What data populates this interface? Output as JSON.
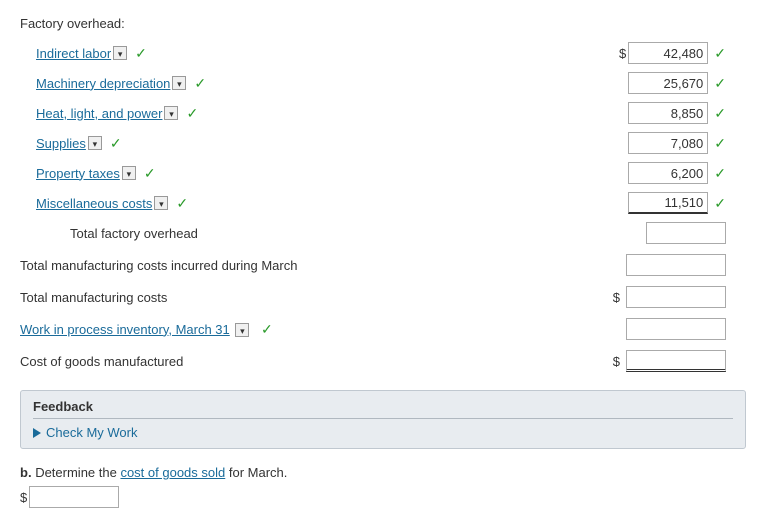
{
  "factory_overhead": {
    "header": "Factory overhead:",
    "items": [
      {
        "label": "Indirect labor",
        "amount": "42,480",
        "has_dollar": true
      },
      {
        "label": "Machinery depreciation",
        "amount": "25,670",
        "has_dollar": false
      },
      {
        "label": "Heat, light, and power",
        "amount": "8,850",
        "has_dollar": false
      },
      {
        "label": "Supplies",
        "amount": "7,080",
        "has_dollar": false
      },
      {
        "label": "Property taxes",
        "amount": "6,200",
        "has_dollar": false
      },
      {
        "label": "Miscellaneous costs",
        "amount": "11,510",
        "has_dollar": false
      }
    ],
    "total_label": "Total factory overhead",
    "total_input": ""
  },
  "total_mfg_costs_incurred": {
    "label": "Total manufacturing costs incurred during March",
    "input": ""
  },
  "total_mfg_costs": {
    "label": "Total manufacturing costs",
    "dollar": "$",
    "input": ""
  },
  "work_in_process": {
    "label": "Work in process inventory, March 31",
    "input": ""
  },
  "cost_of_goods": {
    "label": "Cost of goods manufactured",
    "dollar": "$",
    "input": ""
  },
  "feedback": {
    "header": "Feedback",
    "check_my_work": "Check My Work"
  },
  "part_b": {
    "label_b": "b.",
    "text": " Determine the ",
    "link_text": "cost of goods sold",
    "text2": " for March.",
    "dollar": "$",
    "input": ""
  }
}
